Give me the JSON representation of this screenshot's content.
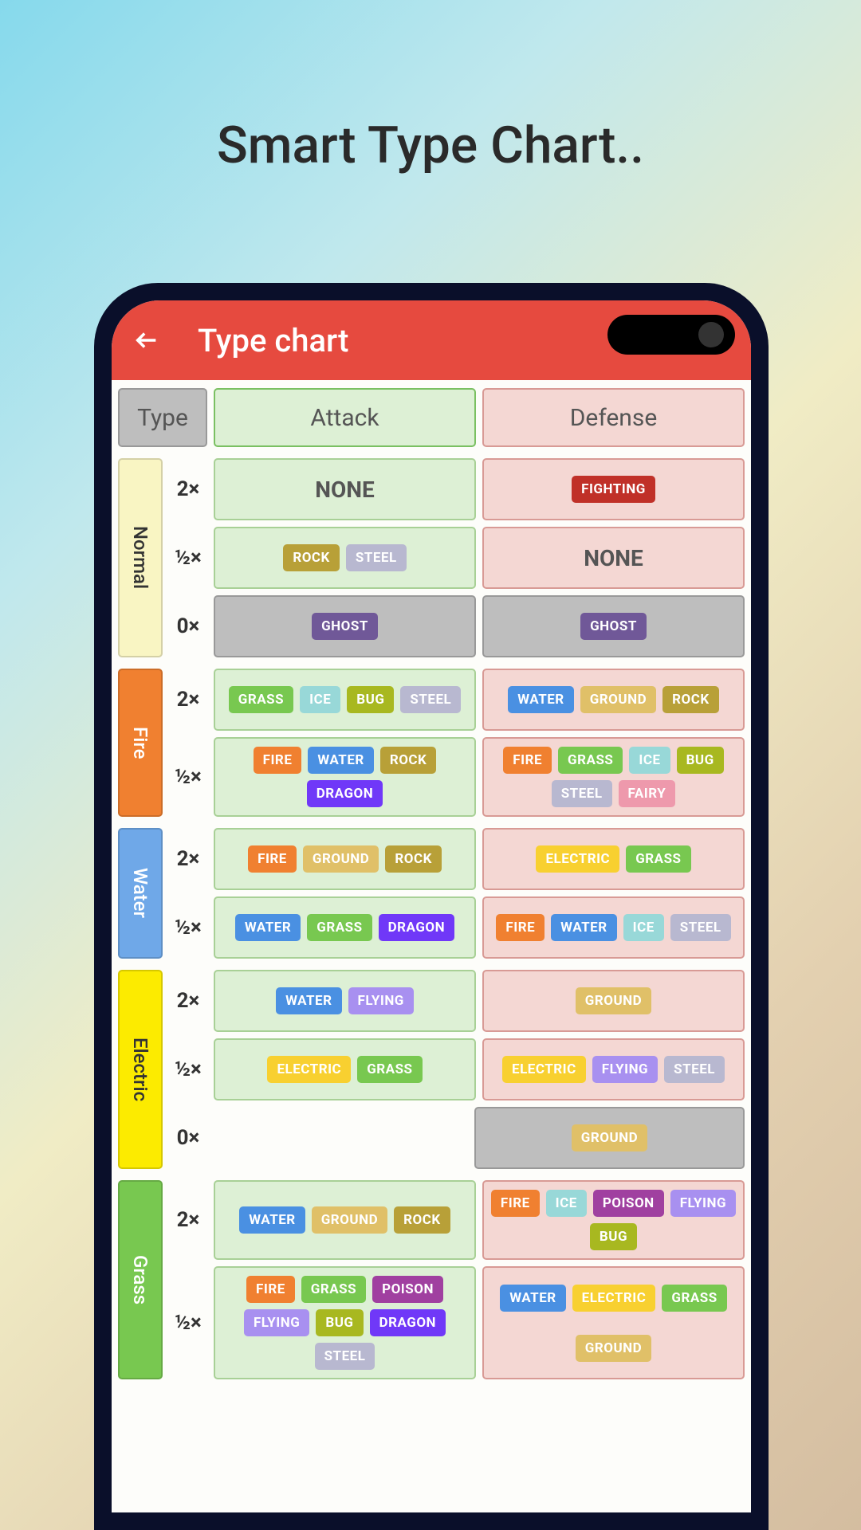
{
  "promo_title": "Smart Type Chart..",
  "app_title": "Type chart",
  "header": {
    "type": "Type",
    "attack": "Attack",
    "defense": "Defense"
  },
  "none_label": "NONE",
  "rows_label": {
    "x2": "2×",
    "x05": "½×",
    "x0": "0×"
  },
  "types": [
    {
      "name": "Normal",
      "rows": [
        {
          "mult": "x2",
          "attack": [],
          "defense": [
            "FIGHTING"
          ]
        },
        {
          "mult": "x05",
          "attack": [
            "ROCK",
            "STEEL"
          ],
          "defense": []
        },
        {
          "mult": "x0",
          "attack": [
            "GHOST"
          ],
          "defense": [
            "GHOST"
          ],
          "zero": true
        }
      ]
    },
    {
      "name": "Fire",
      "rows": [
        {
          "mult": "x2",
          "attack": [
            "GRASS",
            "ICE",
            "BUG",
            "STEEL"
          ],
          "defense": [
            "WATER",
            "GROUND",
            "ROCK"
          ]
        },
        {
          "mult": "x05",
          "attack": [
            "FIRE",
            "WATER",
            "ROCK",
            "DRAGON"
          ],
          "defense": [
            "FIRE",
            "GRASS",
            "ICE",
            "BUG",
            "STEEL",
            "FAIRY"
          ]
        }
      ]
    },
    {
      "name": "Water",
      "rows": [
        {
          "mult": "x2",
          "attack": [
            "FIRE",
            "GROUND",
            "ROCK"
          ],
          "defense": [
            "ELECTRIC",
            "GRASS"
          ]
        },
        {
          "mult": "x05",
          "attack": [
            "WATER",
            "GRASS",
            "DRAGON"
          ],
          "defense": [
            "FIRE",
            "WATER",
            "ICE",
            "STEEL"
          ]
        }
      ]
    },
    {
      "name": "Electric",
      "rows": [
        {
          "mult": "x2",
          "attack": [
            "WATER",
            "FLYING"
          ],
          "defense": [
            "GROUND"
          ]
        },
        {
          "mult": "x05",
          "attack": [
            "ELECTRIC",
            "GRASS"
          ],
          "defense": [
            "ELECTRIC",
            "FLYING",
            "STEEL"
          ]
        },
        {
          "mult": "x0",
          "attack": null,
          "defense": [
            "GROUND"
          ],
          "zero": true
        }
      ]
    },
    {
      "name": "Grass",
      "rows": [
        {
          "mult": "x2",
          "attack": [
            "WATER",
            "GROUND",
            "ROCK"
          ],
          "defense": [
            "FIRE",
            "ICE",
            "POISON",
            "FLYING",
            "BUG"
          ]
        },
        {
          "mult": "x05",
          "attack": [
            "FIRE",
            "GRASS",
            "POISON",
            "FLYING",
            "BUG",
            "DRAGON",
            "STEEL"
          ],
          "defense": [
            "WATER",
            "ELECTRIC",
            "GRASS",
            "GROUND"
          ]
        }
      ]
    }
  ]
}
